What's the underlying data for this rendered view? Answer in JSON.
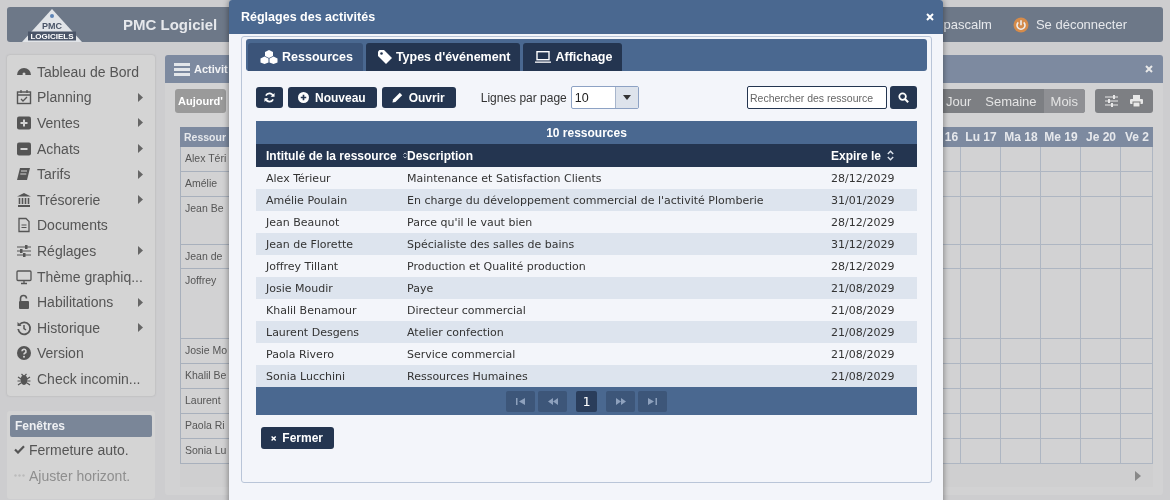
{
  "app_header": {
    "logo_top": "PMC",
    "logo_bottom": "LOGICIELS",
    "title": "PMC Logiciel",
    "user": "pascalm",
    "logout": "Se déconnecter"
  },
  "sidebar": {
    "items": [
      {
        "label": "Tableau de Bord",
        "submenu": false
      },
      {
        "label": "Planning",
        "submenu": true
      },
      {
        "label": "Ventes",
        "submenu": true
      },
      {
        "label": "Achats",
        "submenu": true
      },
      {
        "label": "Tarifs",
        "submenu": true
      },
      {
        "label": "Trésorerie",
        "submenu": true
      },
      {
        "label": "Documents",
        "submenu": false
      },
      {
        "label": "Réglages",
        "submenu": true
      },
      {
        "label": "Thème graphiq...",
        "submenu": false
      },
      {
        "label": "Habilitations",
        "submenu": true
      },
      {
        "label": "Historique",
        "submenu": true
      },
      {
        "label": "Version",
        "submenu": false
      },
      {
        "label": "Check incomin...",
        "submenu": false
      }
    ]
  },
  "windows_panel": {
    "title": "Fenêtres",
    "items": [
      {
        "label": "Fermeture auto.",
        "checked": true,
        "disabled": false
      },
      {
        "label": "Ajuster horizont.",
        "checked": false,
        "disabled": true
      }
    ]
  },
  "planning_window": {
    "title": "Activit",
    "today_button": "Aujourd'",
    "views": [
      {
        "label": "Jour",
        "selected": false
      },
      {
        "label": "Semaine",
        "selected": false
      },
      {
        "label": "Mois",
        "selected": true
      }
    ],
    "resource_header": "Ressour",
    "resources": [
      "Alex Téri",
      "Amélie",
      "Jean Be",
      "Jean de",
      "Joffrey",
      "Josie Mo",
      "Khalil Be",
      "Laurent",
      "Paola Ri",
      "Sonia Lu"
    ],
    "days": [
      "16",
      "Lu 17",
      "Ma 18",
      "Me 19",
      "Je 20",
      "Ve 2"
    ]
  },
  "modal": {
    "title": "Réglages des activités",
    "tabs": [
      {
        "label": "Ressources",
        "selected": true
      },
      {
        "label": "Types d'événement",
        "selected": false
      },
      {
        "label": "Affichage",
        "selected": false
      }
    ],
    "toolbar": {
      "new": "Nouveau",
      "open": "Ouvrir",
      "page_size_label": "Lignes par page",
      "page_size": "10",
      "search": {
        "placeholder": "Rechercher des ressource"
      }
    },
    "table": {
      "caption": "10 ressources",
      "columns": [
        "Intitulé de la ressource",
        "Description",
        "Expire le"
      ],
      "rows": [
        [
          "Alex Térieur",
          "Maintenance et Satisfaction Clients",
          "28/12/2029"
        ],
        [
          "Amélie Poulain",
          "En charge du développement commercial de l'activité Plomberie",
          "31/01/2029"
        ],
        [
          "Jean Beaunot",
          "Parce qu'il le vaut bien",
          "28/12/2029"
        ],
        [
          "Jean de Florette",
          "Spécialiste des salles de bains",
          "31/12/2029"
        ],
        [
          "Joffrey Tillant",
          "Production et Qualité production",
          "28/12/2029"
        ],
        [
          "Josie Moudir",
          "Paye",
          "21/08/2029"
        ],
        [
          "Khalil Benamour",
          "Directeur commercial",
          "21/08/2029"
        ],
        [
          "Laurent Desgens",
          "Atelier confection",
          "21/08/2029"
        ],
        [
          "Paola Rivero",
          "Service commercial",
          "21/08/2029"
        ],
        [
          "Sonia Lucchini",
          "Ressources Humaines",
          "21/08/2029"
        ]
      ]
    },
    "pager": {
      "page": "1"
    },
    "close": "Fermer"
  }
}
